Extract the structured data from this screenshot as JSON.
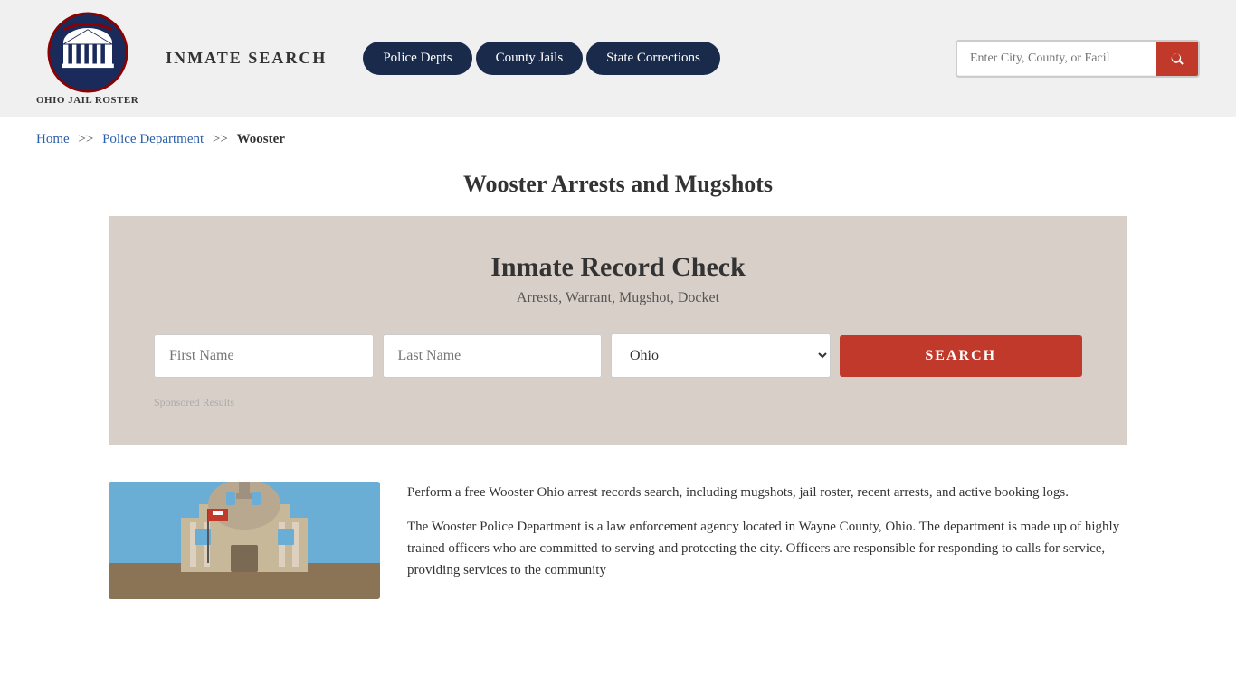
{
  "header": {
    "logo_text": "Ohio Jail Roster",
    "site_title": "Inmate Search",
    "nav": [
      {
        "label": "Police Depts",
        "key": "police-depts"
      },
      {
        "label": "County Jails",
        "key": "county-jails"
      },
      {
        "label": "State Corrections",
        "key": "state-corrections"
      }
    ],
    "search_placeholder": "Enter City, County, or Facil"
  },
  "breadcrumb": {
    "home": "Home",
    "sep1": ">>",
    "section": "Police Department",
    "sep2": ">>",
    "current": "Wooster"
  },
  "page": {
    "title": "Wooster Arrests and Mugshots"
  },
  "record_check": {
    "title": "Inmate Record Check",
    "subtitle": "Arrests, Warrant, Mugshot, Docket",
    "first_name_placeholder": "First Name",
    "last_name_placeholder": "Last Name",
    "state_default": "Ohio",
    "search_button": "SEARCH",
    "sponsored_label": "Sponsored Results"
  },
  "content": {
    "paragraph1": "Perform a free Wooster Ohio arrest records search, including mugshots, jail roster, recent arrests, and active booking logs.",
    "paragraph2": "The Wooster Police Department is a law enforcement agency located in Wayne County, Ohio. The department is made up of highly trained officers who are committed to serving and protecting the city. Officers are responsible for responding to calls for service, providing services to the community"
  }
}
